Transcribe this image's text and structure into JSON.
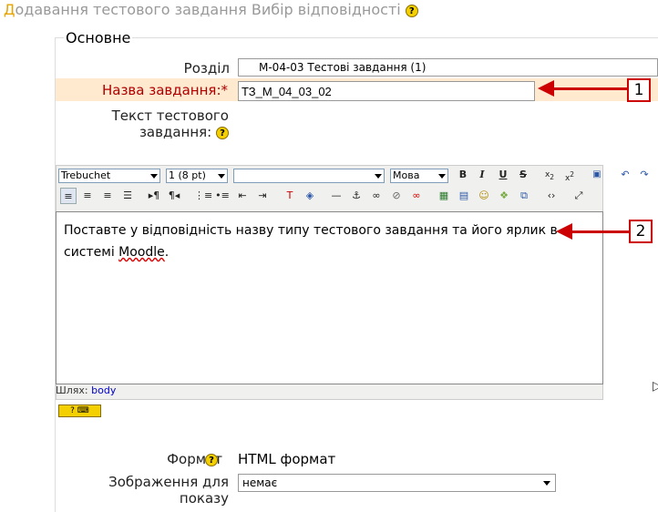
{
  "page_title": {
    "first_letter": "Д",
    "rest": "одавання тестового завдання Вибір відповідності",
    "help": "?"
  },
  "section_legend": "Основне",
  "fields": {
    "category": {
      "label": "Розділ",
      "value": "М-04-03 Тестові завдання (1)"
    },
    "name": {
      "label": "Назва завдання:",
      "required_mark": "*",
      "value": "ТЗ_М_04_03_02"
    },
    "text": {
      "label_line1": "Текст тестового",
      "label_line2": "завдання:"
    },
    "format": {
      "label": "Формат",
      "value": "HTML формат"
    },
    "image": {
      "label_line1": "Зображення для",
      "label_line2": "показу",
      "value": "немає"
    }
  },
  "callouts": {
    "one": "1",
    "two": "2"
  },
  "editor": {
    "font": "Trebuchet",
    "size": "1 (8 pt)",
    "style": "",
    "language": "Мова",
    "content_part1": "Поставте у відповідність назву типу тестового завдання та його ярлик в системі ",
    "content_spell": "Moodle",
    "content_end": ".",
    "path_label": "Шлях:",
    "path_value": "body"
  },
  "colors": {
    "accent": "#cc0000",
    "highlight": "#ffe9cf",
    "help": "#f5d000"
  }
}
